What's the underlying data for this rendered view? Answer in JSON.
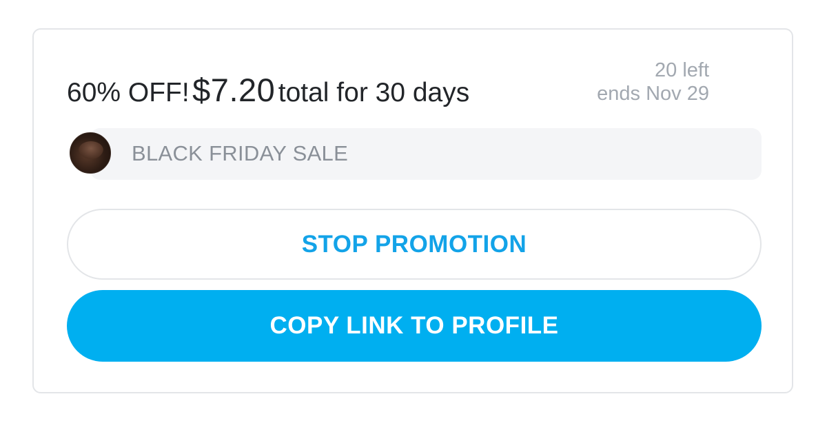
{
  "promotion": {
    "discount_label": "60% OFF!",
    "price": "$7.20",
    "duration_label": "total for 30 days",
    "remaining": "20 left",
    "ends": "ends Nov 29",
    "message": "BLACK FRIDAY SALE"
  },
  "actions": {
    "stop_label": "STOP PROMOTION",
    "copy_label": "COPY LINK TO PROFILE"
  },
  "colors": {
    "accent": "#00aff0",
    "accent_text": "#13a3e8",
    "muted": "#a2a8b0",
    "border": "#e3e5e8"
  }
}
